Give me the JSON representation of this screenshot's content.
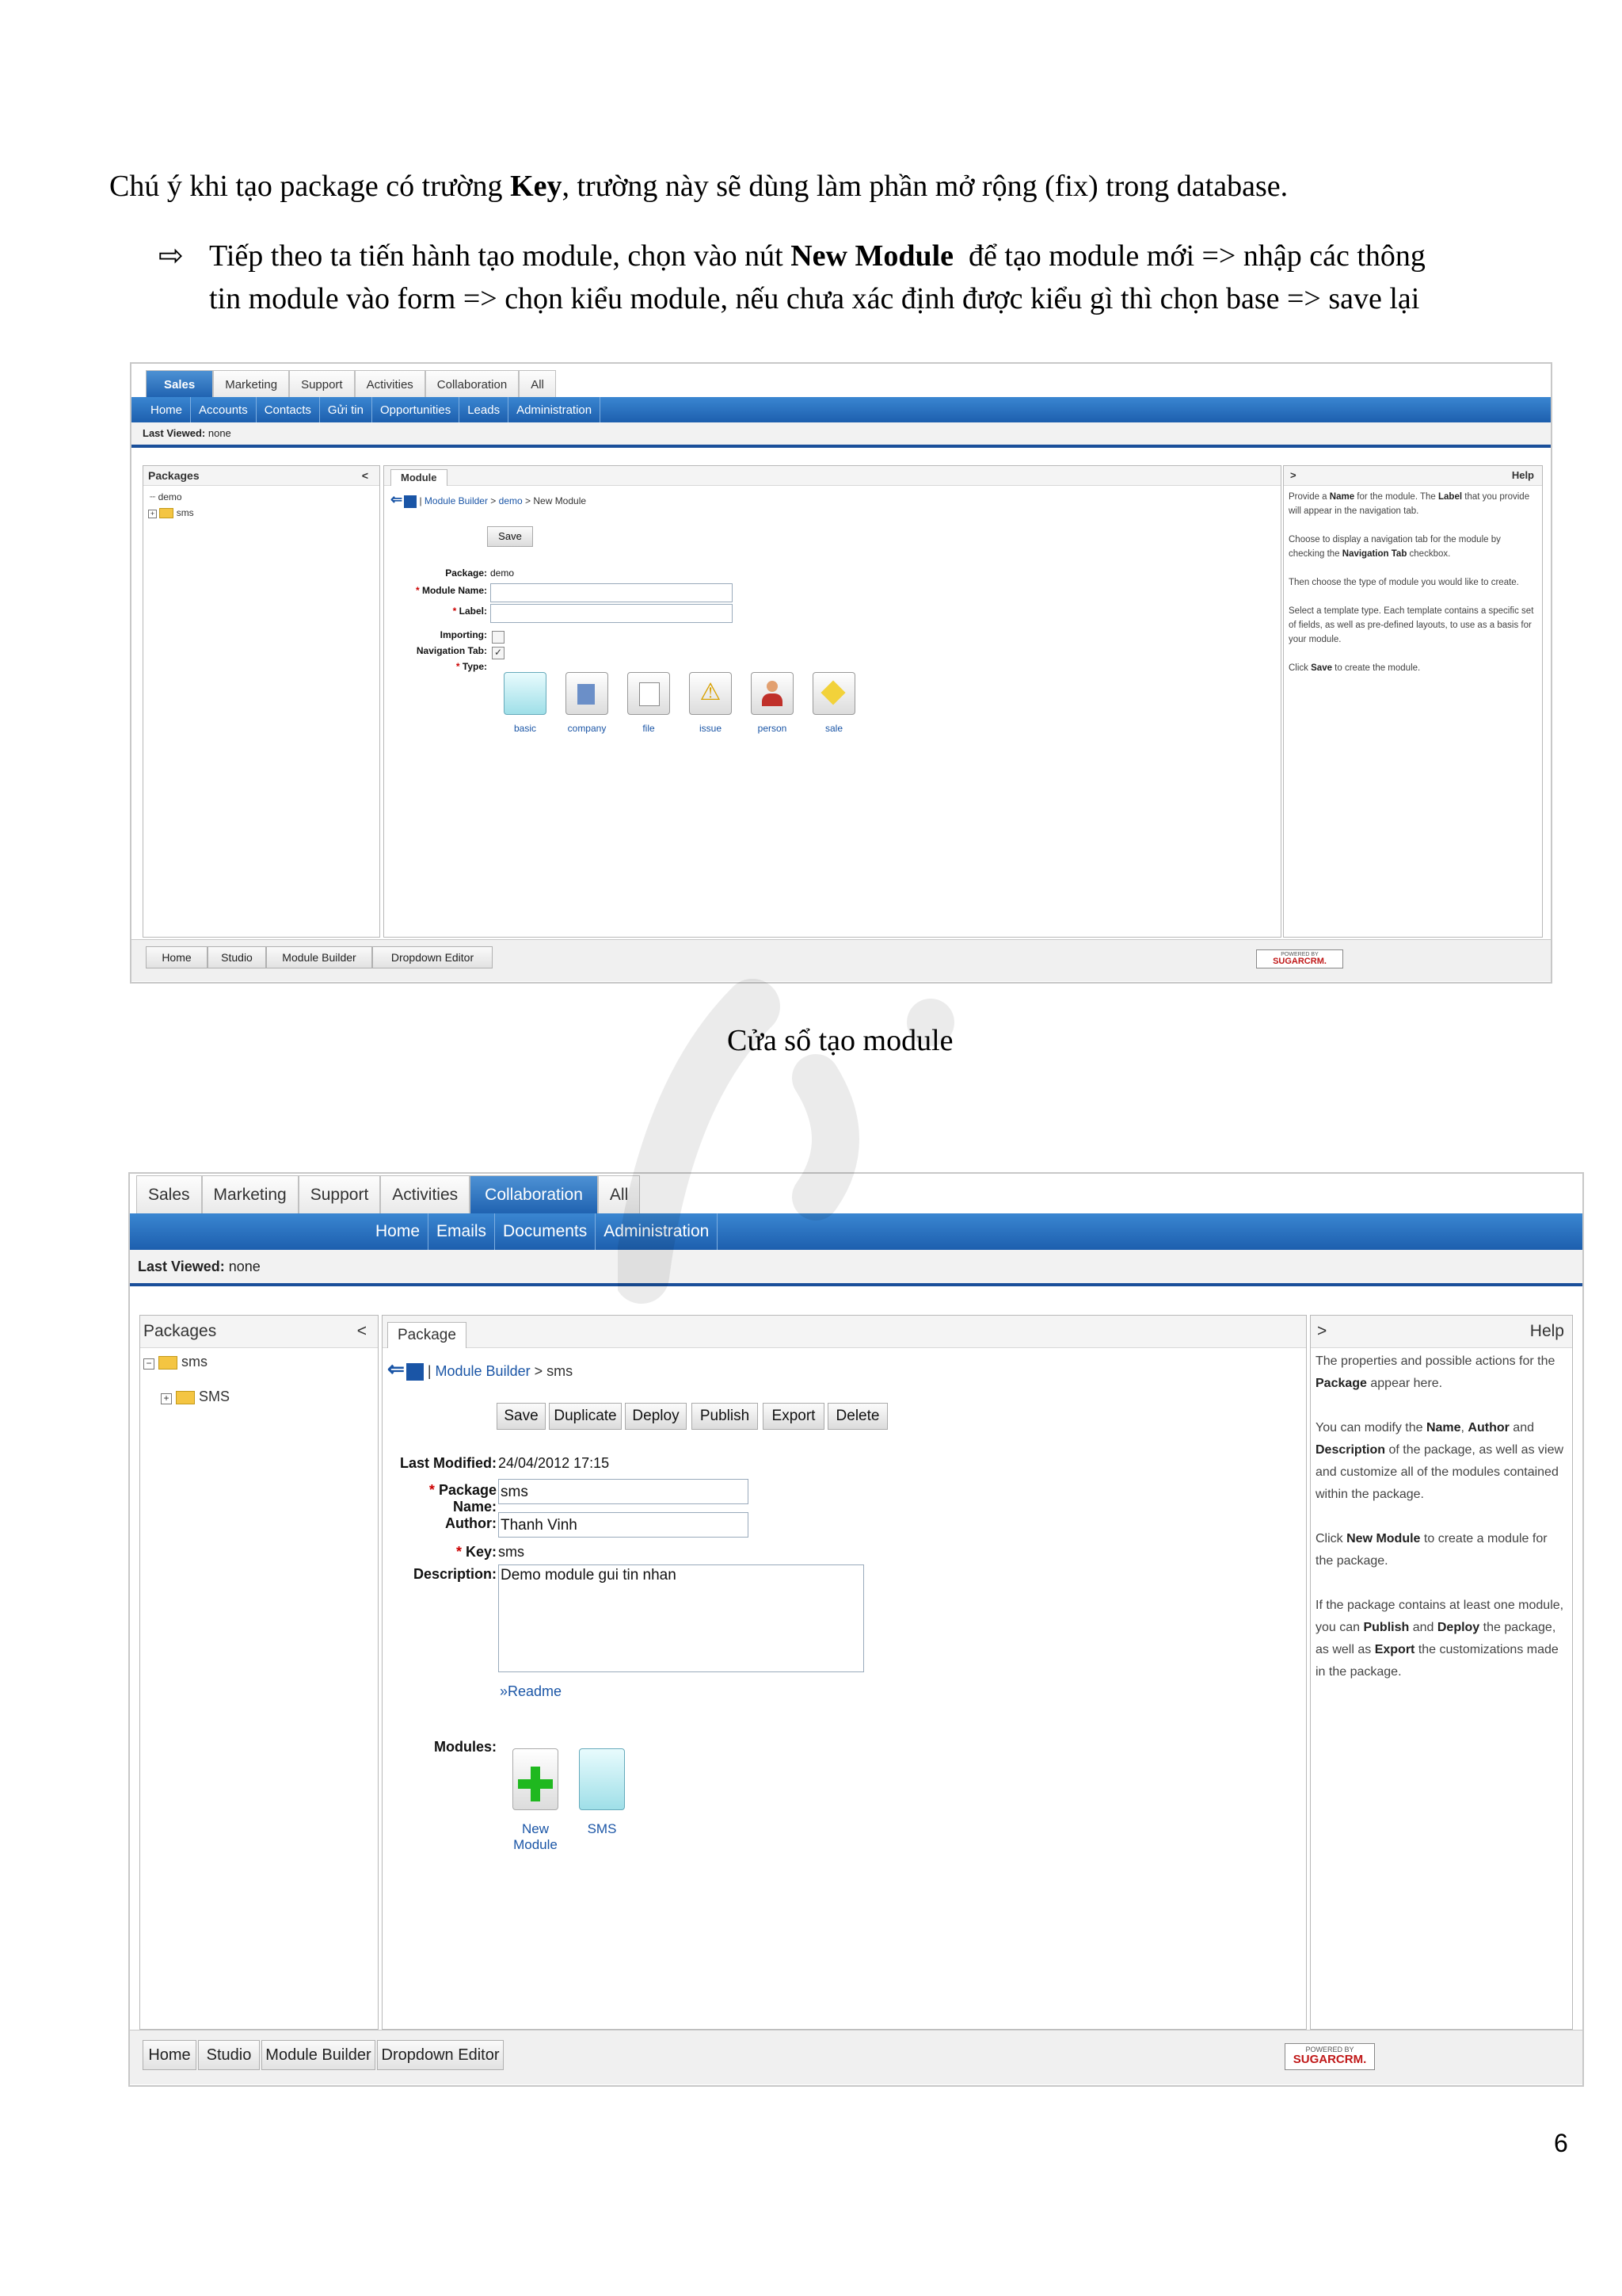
{
  "doc": {
    "para1_pre": "Chú ý khi tạo package có trường ",
    "para1_bold": "Key",
    "para1_post": ", trường này sẽ dùng làm phần mở rộng (fix) trong database.",
    "bullet_glyph": "⇨",
    "bullet_pre": "Tiếp theo ta tiến hành tạo module, chọn vào nút ",
    "bullet_bold": "New Module",
    "bullet_post1": "  để tạo module mới => nhập các thông",
    "bullet_line2": "tin module vào form => chọn kiểu module, nếu chưa xác định được kiểu gì thì chọn base => save lại",
    "caption": "Cửa sổ tạo module",
    "page_number": "6"
  },
  "shot1": {
    "tabs": [
      "Sales",
      "Marketing",
      "Support",
      "Activities",
      "Collaboration",
      "All"
    ],
    "subnav": [
      "Home",
      "Accounts",
      "Contacts",
      "Gửi tin",
      "Opportunities",
      "Leads",
      "Administration"
    ],
    "last_viewed_label": "Last Viewed:",
    "last_viewed_value": "none",
    "packages_title": "Packages",
    "collapse": "<",
    "tree": [
      "demo",
      "sms"
    ],
    "center_tab": "Module",
    "breadcrumb_link1": "Module Builder",
    "breadcrumb_sep1": " > ",
    "breadcrumb_link2": "demo",
    "breadcrumb_tail": " > New Module",
    "breadcrumb_bar": "|",
    "save": "Save",
    "package_label": "Package:",
    "package_value": "demo",
    "module_name_label": "Module Name:",
    "label_label": "Label:",
    "importing_label": "Importing:",
    "navtab_label": "Navigation Tab:",
    "type_label": "Type:",
    "types": [
      "basic",
      "company",
      "file",
      "issue",
      "person",
      "sale"
    ],
    "help_expand": ">",
    "help_title": "Help",
    "help": [
      [
        "Provide a ",
        "Name",
        " for the module. The ",
        "Label",
        " that you provide will appear in the navigation tab."
      ],
      [
        "Choose to display a navigation tab for the module by checking the ",
        "Navigation Tab",
        " checkbox."
      ],
      [
        "Then choose the type of module you would like to create."
      ],
      [
        "Select a template type. Each template contains a specific set of fields, as well as pre-defined layouts, to use as a basis for your module."
      ],
      [
        "Click ",
        "Save",
        " to create the module."
      ]
    ],
    "footer": [
      "Home",
      "Studio",
      "Module Builder",
      "Dropdown Editor"
    ],
    "powered": "POWERED BY",
    "sugar": "SUGARCRM."
  },
  "shot2": {
    "tabs": [
      "Sales",
      "Marketing",
      "Support",
      "Activities",
      "Collaboration",
      "All"
    ],
    "subnav": [
      "Home",
      "Emails",
      "Documents",
      "Administration"
    ],
    "last_viewed_label": "Last Viewed:",
    "last_viewed_value": "none",
    "packages_title": "Packages",
    "collapse": "<",
    "tree": [
      "sms",
      "SMS"
    ],
    "center_tab": "Package",
    "breadcrumb_bar": "|",
    "breadcrumb_link1": "Module Builder",
    "breadcrumb_tail": " > sms",
    "buttons": [
      "Save",
      "Duplicate",
      "Deploy",
      "Publish",
      "Export",
      "Delete"
    ],
    "last_modified_label": "Last Modified:",
    "last_modified_value": "24/04/2012 17:15",
    "package_name_label": "Package Name:",
    "package_name_value": "sms",
    "author_label": "Author:",
    "author_value": "Thanh Vinh",
    "key_label": "Key:",
    "key_value": "sms",
    "description_label": "Description:",
    "description_value": "Demo module gui tin nhan",
    "readme": "Readme",
    "modules_label": "Modules:",
    "modules": [
      "New Module",
      "SMS"
    ],
    "help_expand": ">",
    "help_title": "Help",
    "help": [
      [
        "The properties and possible actions for the ",
        "Package",
        " appear here."
      ],
      [
        "You can modify the ",
        "Name",
        ", ",
        "Author",
        " and ",
        "Description",
        " of the package, as well as view and customize all of the modules contained within the package."
      ],
      [
        "Click ",
        "New Module",
        " to create a module for the package."
      ],
      [
        "If the package contains at least one module, you can ",
        "Publish",
        " and ",
        "Deploy",
        " the package, as well as ",
        "Export",
        " the customizations made in the package."
      ]
    ],
    "footer": [
      "Home",
      "Studio",
      "Module Builder",
      "Dropdown Editor"
    ],
    "powered": "POWERED BY",
    "sugar": "SUGARCRM."
  }
}
